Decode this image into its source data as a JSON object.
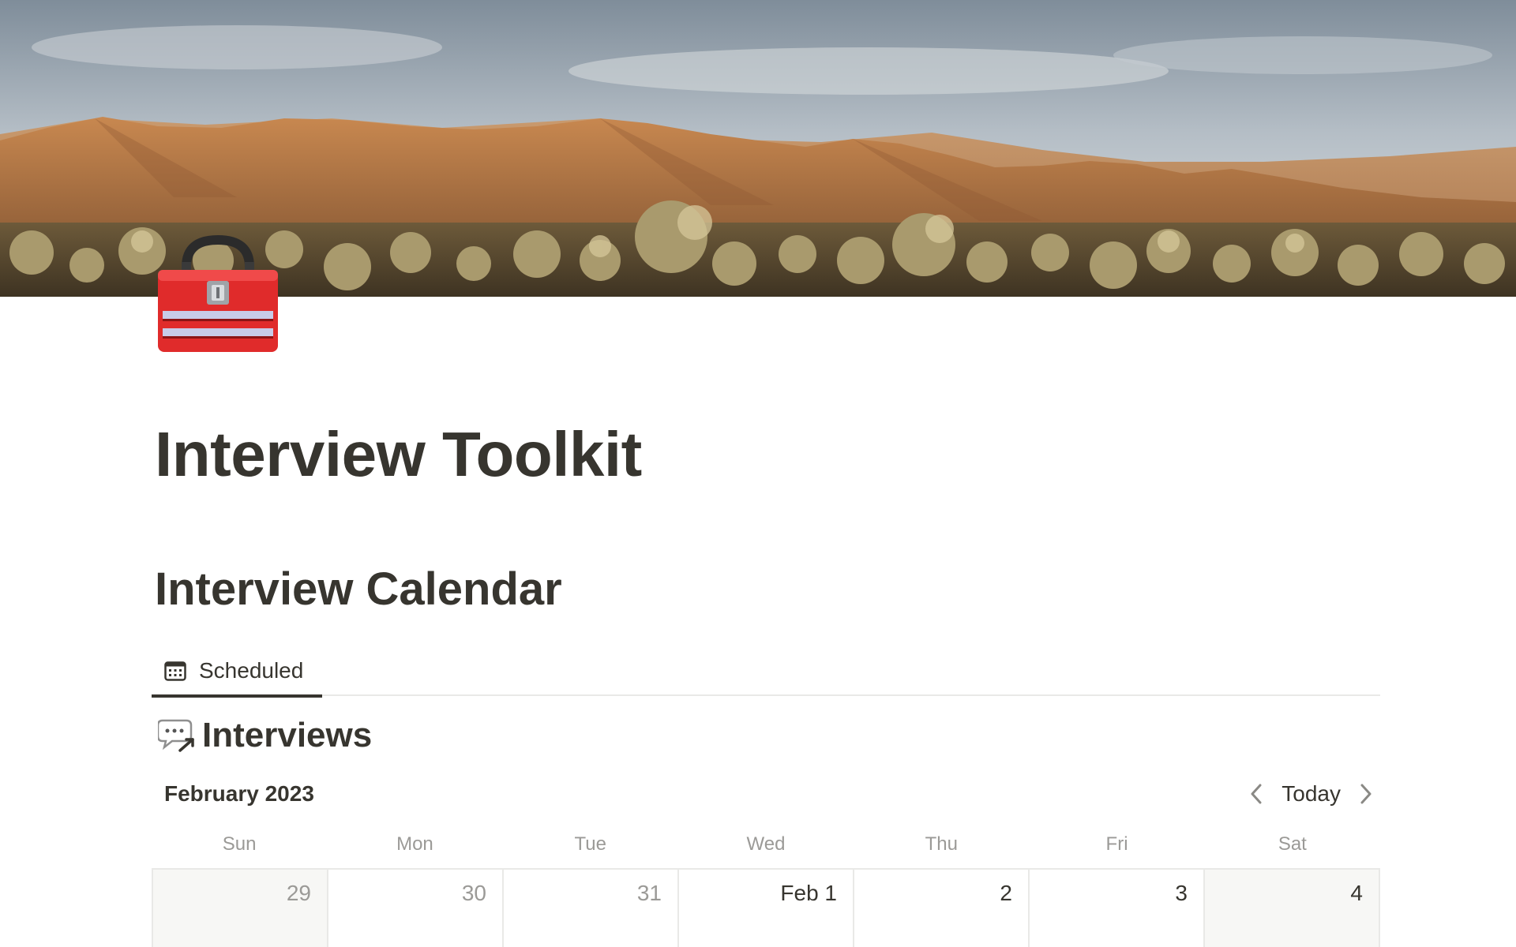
{
  "page": {
    "title": "Interview Toolkit",
    "icon": "toolbox-icon",
    "cover": "desert-mountain-landscape"
  },
  "section": {
    "heading": "Interview Calendar"
  },
  "tabs": [
    {
      "label": "Scheduled",
      "icon": "calendar-icon",
      "active": true
    }
  ],
  "database": {
    "icon": "speech-bubble-icon",
    "title": "Interviews"
  },
  "calendar": {
    "month": "February 2023",
    "today_label": "Today",
    "weekdays": [
      "Sun",
      "Mon",
      "Tue",
      "Wed",
      "Thu",
      "Fri",
      "Sat"
    ],
    "days": [
      "29",
      "30",
      "31",
      "Feb 1",
      "2",
      "3",
      "4"
    ]
  },
  "colors": {
    "text": "#37352f",
    "muted_text": "#9b9a97",
    "border": "#e9e9e7",
    "weekend_bg": "#f7f7f5"
  }
}
